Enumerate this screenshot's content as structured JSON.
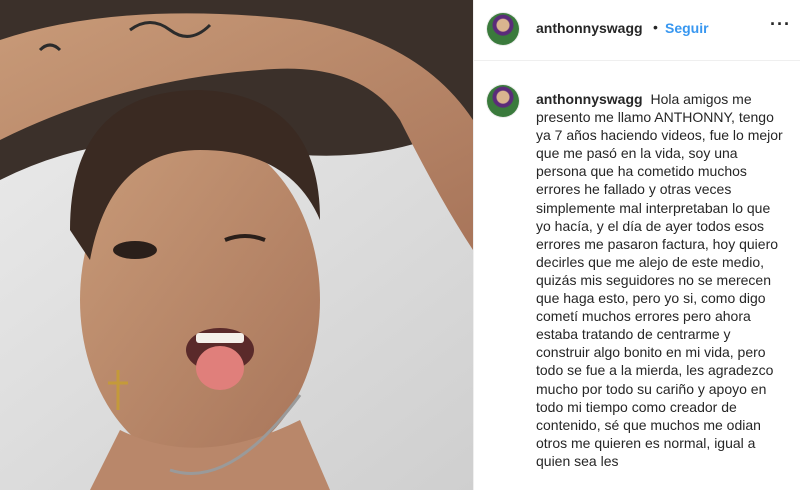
{
  "header": {
    "username": "anthonnyswagg",
    "separator": "•",
    "follow_label": "Seguir",
    "more_icon": "more-options-icon",
    "more_glyph": "···"
  },
  "caption": {
    "username": "anthonnyswagg",
    "text": "Hola amigos me presento me llamo ANTHONNY, tengo ya 7 años haciendo videos, fue lo mejor que me pasó en la vida, soy una persona que ha cometido muchos errores he fallado y otras veces simplemente mal interpretaban lo que yo hacía, y el día de ayer todos esos errores me pasaron factura, hoy quiero decirles que me alejo de este medio, quizás mis seguidores no se merecen que haga esto, pero yo si, como digo cometí muchos errores pero ahora estaba tratando de centrarme y construir algo bonito en mi vida, pero todo se fue a la mierda, les agradezco mucho por todo su cariño y apoyo en todo mi tiempo como creador de contenido, sé que muchos me odian otros me quieren es normal, igual a quien sea les"
  },
  "colors": {
    "accent": "#3897f0",
    "text": "#262626",
    "border": "#efefef"
  }
}
